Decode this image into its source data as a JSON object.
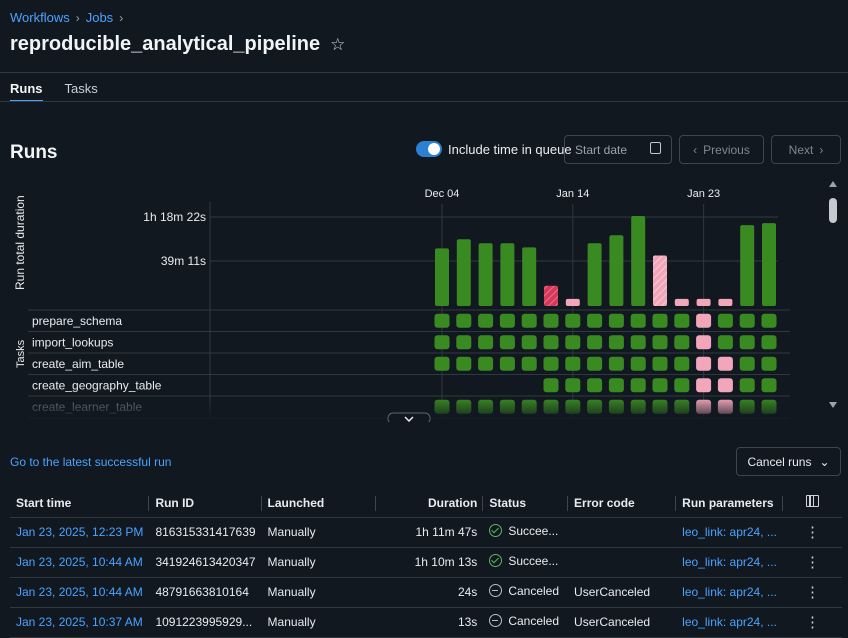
{
  "breadcrumb": [
    "Workflows",
    "Jobs"
  ],
  "page": {
    "title": "reproducible_analytical_pipeline"
  },
  "tabs": [
    "Runs",
    "Tasks"
  ],
  "runs": {
    "heading": "Runs",
    "include_queue_label": "Include time in queue",
    "include_queue_on": true,
    "start_date_placeholder": "Start date",
    "previous_label": "Previous",
    "next_label": "Next",
    "latest_link": "Go to the latest successful run",
    "cancel_label": "Cancel runs"
  },
  "chart_data": {
    "type": "bar",
    "ylabel": "Run total duration",
    "yticks": [
      "1h 18m 22s",
      "39m 11s"
    ],
    "date_labels": [
      {
        "label": "Dec 04",
        "index": 0
      },
      {
        "label": "Jan 14",
        "index": 6
      },
      {
        "label": "Jan 23",
        "index": 12
      }
    ],
    "colors": {
      "success": "#3a8a22",
      "canceled": "#f1a7b9",
      "failed": "#d63a5a",
      "cell_success": "#3a8a22"
    },
    "ylim_minutes": [
      0,
      89
    ],
    "runs": [
      {
        "minutes": 57,
        "status": "success"
      },
      {
        "minutes": 66,
        "status": "success"
      },
      {
        "minutes": 62,
        "status": "success"
      },
      {
        "minutes": 62,
        "status": "success"
      },
      {
        "minutes": 58,
        "status": "success"
      },
      {
        "minutes": 20,
        "status": "failed"
      },
      {
        "minutes": 7,
        "status": "canceled"
      },
      {
        "minutes": 62,
        "status": "success"
      },
      {
        "minutes": 70,
        "status": "success"
      },
      {
        "minutes": 89,
        "status": "success"
      },
      {
        "minutes": 50,
        "status": "canceled-striped"
      },
      {
        "minutes": 7,
        "status": "canceled"
      },
      {
        "minutes": 7,
        "status": "canceled"
      },
      {
        "minutes": 7,
        "status": "canceled"
      },
      {
        "minutes": 80,
        "status": "success"
      },
      {
        "minutes": 82,
        "status": "success"
      }
    ],
    "task_axis_label": "Tasks",
    "tasks": [
      {
        "name": "prepare_schema",
        "cells": [
          "s",
          "s",
          "s",
          "s",
          "s",
          "s",
          "s",
          "s",
          "s",
          "s",
          "s",
          "s",
          "c",
          "s",
          "s",
          "s"
        ]
      },
      {
        "name": "import_lookups",
        "cells": [
          "s",
          "s",
          "s",
          "s",
          "s",
          "s",
          "s",
          "s",
          "s",
          "s",
          "s",
          "s",
          "c",
          "s",
          "s",
          "s"
        ]
      },
      {
        "name": "create_aim_table",
        "cells": [
          "s",
          "s",
          "s",
          "s",
          "s",
          "s",
          "s",
          "s",
          "s",
          "s",
          "s",
          "s",
          "c",
          "c",
          "s",
          "s"
        ]
      },
      {
        "name": "create_geography_table",
        "cells": [
          "",
          "",
          "",
          "",
          "",
          "s",
          "s",
          "s",
          "s",
          "s",
          "s",
          "s",
          "c",
          "c",
          "s",
          "s"
        ]
      },
      {
        "name": "create_learner_table",
        "cells": [
          "s",
          "s",
          "s",
          "s",
          "s",
          "s",
          "s",
          "s",
          "s",
          "s",
          "s",
          "s",
          "c",
          "c",
          "s",
          "s"
        ]
      }
    ]
  },
  "table": {
    "headers": [
      "Start time",
      "Run ID",
      "Launched",
      "Duration",
      "Status",
      "Error code",
      "Run parameters"
    ],
    "rows": [
      {
        "start": "Jan 23, 2025, 12:23 PM",
        "id": "816315331417639",
        "launched": "Manually",
        "duration": "1h 11m 47s",
        "status": "Succee...",
        "status_kind": "success",
        "error": "",
        "params": "leo_link: apr24, ..."
      },
      {
        "start": "Jan 23, 2025, 10:44 AM",
        "id": "341924613420347",
        "launched": "Manually",
        "duration": "1h 10m 13s",
        "status": "Succee...",
        "status_kind": "success",
        "error": "",
        "params": "leo_link: apr24, ..."
      },
      {
        "start": "Jan 23, 2025, 10:44 AM",
        "id": "48791663810164",
        "launched": "Manually",
        "duration": "24s",
        "status": "Canceled",
        "status_kind": "canceled",
        "error": "UserCanceled",
        "params": "leo_link: apr24, ..."
      },
      {
        "start": "Jan 23, 2025, 10:37 AM",
        "id": "1091223995929...",
        "launched": "Manually",
        "duration": "13s",
        "status": "Canceled",
        "status_kind": "canceled",
        "error": "UserCanceled",
        "params": "leo_link: apr24, ..."
      }
    ]
  }
}
